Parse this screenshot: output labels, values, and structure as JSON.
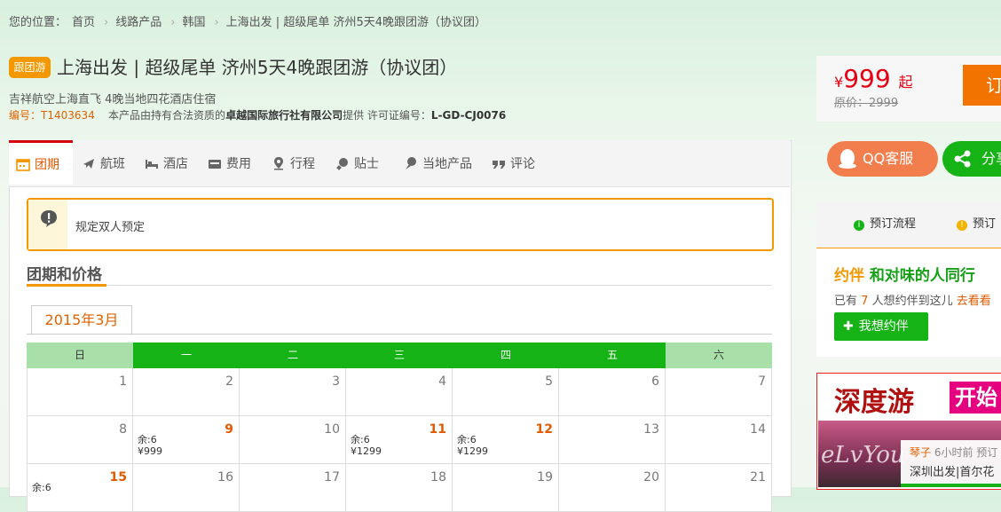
{
  "breadcrumb": {
    "prefix": "您的位置：",
    "items": [
      "首页",
      "线路产品",
      "韩国",
      "上海出发 | 超级尾单 济州5天4晚跟团游（协议团）"
    ]
  },
  "product": {
    "badge": "跟团游",
    "title": "上海出发 | 超级尾单 济州5天4晚跟团游（协议团）",
    "subtitle": "吉祥航空上海直飞 4晚当地四花酒店住宿",
    "code_label": "编号：T1403634",
    "supplier_pre": "本产品由持有合法资质的",
    "supplier_name": "卓越国际旅行社有限公司",
    "supplier_post": "提供 许可证编号：",
    "license": "L-GD-CJ0076"
  },
  "tabs": [
    {
      "label": "团期",
      "icon": "calendar-icon"
    },
    {
      "label": "航班",
      "icon": "plane-icon"
    },
    {
      "label": "酒店",
      "icon": "bed-icon"
    },
    {
      "label": "费用",
      "icon": "wallet-icon"
    },
    {
      "label": "行程",
      "icon": "location-pin-icon"
    },
    {
      "label": "贴士",
      "icon": "tips-icon"
    },
    {
      "label": "当地产品",
      "icon": "local-product-icon"
    },
    {
      "label": "评论",
      "icon": "quote-icon"
    }
  ],
  "notice": {
    "icon": "alert-icon",
    "text": "规定双人预定"
  },
  "section": {
    "title": "团期和价格"
  },
  "calendar": {
    "month": "2015年3月",
    "weekdays": [
      "日",
      "一",
      "二",
      "三",
      "四",
      "五",
      "六"
    ],
    "rows": [
      [
        {
          "d": "1"
        },
        {
          "d": "2"
        },
        {
          "d": "3"
        },
        {
          "d": "4"
        },
        {
          "d": "5"
        },
        {
          "d": "6"
        },
        {
          "d": "7"
        }
      ],
      [
        {
          "d": "8"
        },
        {
          "d": "9",
          "hot": true,
          "rem": "余:6",
          "price": "¥999"
        },
        {
          "d": "10"
        },
        {
          "d": "11",
          "hot": true,
          "rem": "余:6",
          "price": "¥1299"
        },
        {
          "d": "12",
          "hot": true,
          "rem": "余:6",
          "price": "¥1299"
        },
        {
          "d": "13"
        },
        {
          "d": "14"
        }
      ],
      [
        {
          "d": "15",
          "hot": true,
          "rem": "余:6",
          "price": ""
        },
        {
          "d": "16"
        },
        {
          "d": "17"
        },
        {
          "d": "18"
        },
        {
          "d": "19"
        },
        {
          "d": "20"
        },
        {
          "d": "21"
        }
      ]
    ]
  },
  "sidebar": {
    "price_symbol": "¥",
    "price": "999",
    "price_suffix": "起",
    "original_price": "原价：2999",
    "order_label": "订",
    "qq_label": "QQ客服",
    "share_label": "分享",
    "flow_1": "预订流程",
    "flow_2": "预订",
    "yue_prefix": "约伴",
    "yue_title": "和对味的人同行",
    "yue_count_pre": "已有",
    "yue_count": "7",
    "yue_count_post": "人想约伴到这儿",
    "yue_link": "去看看",
    "yue_button": "我想约伴",
    "ad_logo": "深度游",
    "ad_open": "开始",
    "ad_user": "琴子",
    "ad_time": "6小时前 预订",
    "ad_dest": "深圳出发|首尔花",
    "watermark": "eLvYou"
  },
  "colors": {
    "accent_orange": "#f39800",
    "brand_green": "#16b316",
    "price_red": "#e60012"
  }
}
